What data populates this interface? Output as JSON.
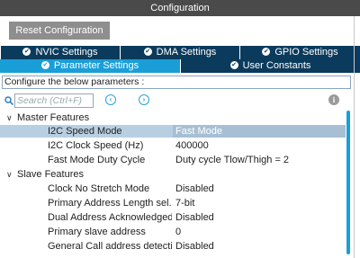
{
  "window": {
    "title": "Configuration"
  },
  "toolbar": {
    "reset_label": "Reset Configuration"
  },
  "tabs_row1": [
    {
      "label": "NVIC Settings"
    },
    {
      "label": "DMA Settings"
    },
    {
      "label": "GPIO Settings"
    }
  ],
  "tabs_row2": [
    {
      "label": "Parameter Settings",
      "active": true
    },
    {
      "label": "User Constants",
      "active": false
    }
  ],
  "config_prompt": "Configure the below parameters :",
  "search": {
    "placeholder": "Search (Ctrl+F)"
  },
  "groups": {
    "master": {
      "label": "Master Features"
    },
    "slave": {
      "label": "Slave Features"
    }
  },
  "master_params": [
    {
      "name": "I2C Speed Mode",
      "value": "Fast Mode",
      "selected": true
    },
    {
      "name": "I2C Clock Speed (Hz)",
      "value": "400000"
    },
    {
      "name": "Fast Mode Duty Cycle",
      "value": "Duty cycle Tlow/Thigh = 2"
    }
  ],
  "slave_params": [
    {
      "name": "Clock No Stretch Mode",
      "value": "Disabled"
    },
    {
      "name": "Primary Address Length sel...",
      "value": "7-bit"
    },
    {
      "name": "Dual Address Acknowledged",
      "value": "Disabled"
    },
    {
      "name": "Primary slave address",
      "value": "0"
    },
    {
      "name": "General Call address detection",
      "value": "Disabled"
    }
  ],
  "colors": {
    "titlebar": "#4a4a4a",
    "tab_dark": "#0b3b5c",
    "tab_active": "#1a9ed8",
    "selected_row": "#b8cfe2"
  }
}
